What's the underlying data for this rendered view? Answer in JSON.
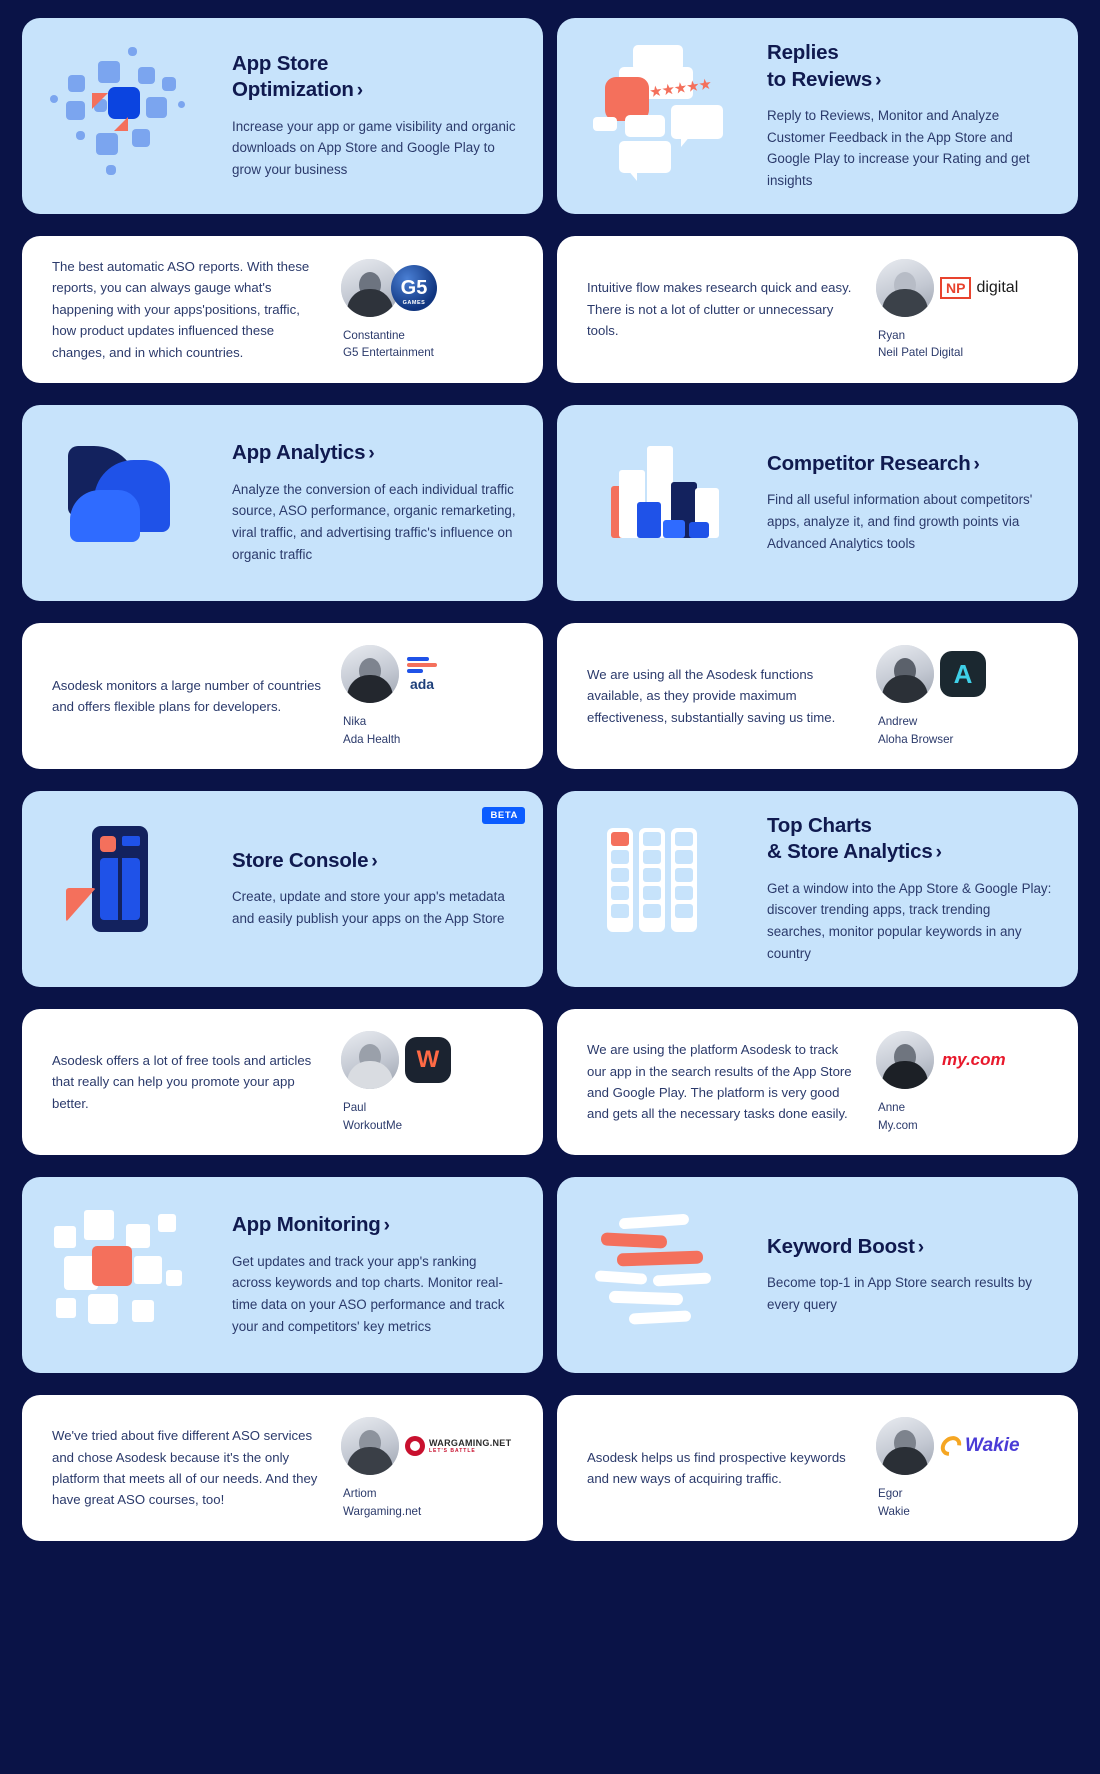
{
  "theme": {
    "page_bg": "#0a1347",
    "feature_card_bg": "#c7e3fb",
    "quote_card_bg": "#ffffff",
    "heading_color": "#101a4f",
    "body_color": "#2b3a6b",
    "accent_blue": "#0b5cff",
    "accent_coral": "#f4705c"
  },
  "features": [
    {
      "id": "app-store-optimization",
      "title_line1": "App Store",
      "title_line2": "Optimization",
      "chevron": "›",
      "description": "Increase your app or game visibility and organic downloads on App Store and Google Play to grow your business",
      "icon": "squares-cluster-icon",
      "badge": null
    },
    {
      "id": "replies-to-reviews",
      "title_line1": "Replies",
      "title_line2": "to Reviews",
      "chevron": "›",
      "description": "Reply to Reviews, Monitor and Analyze Customer Feedback in the App Store and Google Play to increase your Rating and get insights",
      "icon": "speech-bubbles-stars-icon",
      "badge": null
    },
    {
      "id": "app-analytics",
      "title_line1": "App Analytics",
      "title_line2": "",
      "chevron": "›",
      "description": "Analyze the conversion of each individual traffic source, ASO performance, organic remarketing, viral traffic, and advertising traffic's influence on organic traffic",
      "icon": "mountains-chart-icon",
      "badge": null
    },
    {
      "id": "competitor-research",
      "title_line1": "Competitor Research",
      "title_line2": "",
      "chevron": "›",
      "description": "Find all useful information about competitors' apps, analyze it, and find growth points via Advanced Analytics tools",
      "icon": "bar-blocks-icon",
      "badge": null
    },
    {
      "id": "store-console",
      "title_line1": "Store Console",
      "title_line2": "",
      "chevron": "›",
      "description": "Create, update and store your app's metadata and easily publish your apps on the App Store",
      "icon": "phone-screen-icon",
      "badge": "BETA"
    },
    {
      "id": "top-charts-store-analytics",
      "title_line1": "Top Charts",
      "title_line2": "& Store Analytics",
      "chevron": "›",
      "description": "Get a window into the App Store & Google Play: discover trending apps, track trending searches, monitor popular keywords in any country",
      "icon": "chart-columns-icon",
      "badge": null
    },
    {
      "id": "app-monitoring",
      "title_line1": "App Monitoring",
      "title_line2": "",
      "chevron": "›",
      "description": "Get updates and track your app's ranking across keywords and top charts. Monitor real-time data on your ASO performance and track your and competitors' key metrics",
      "icon": "overlapping-squares-icon",
      "badge": null
    },
    {
      "id": "keyword-boost",
      "title_line1": "Keyword Boost",
      "title_line2": "",
      "chevron": "›",
      "description": "Become top-1 in App Store search results by every query",
      "icon": "stacked-bars-icon",
      "badge": null
    }
  ],
  "testimonials": [
    {
      "id": "constantine-g5",
      "text": "The best automatic ASO reports. With these reports, you can always gauge what's happening with your apps'positions, traffic, how product updates influenced these changes, and in which countries.",
      "name": "Constantine",
      "company": "G5 Entertainment",
      "logo": "g5-games-logo",
      "logo_text": "G5",
      "logo_sub": "GAMES"
    },
    {
      "id": "ryan-neil-patel-digital",
      "text": "Intuitive flow makes research quick and easy. There is not a lot of clutter or unnecessary tools.",
      "name": "Ryan",
      "company": "Neil Patel Digital",
      "logo": "np-digital-logo",
      "logo_text": "NP",
      "logo_sub": "digital"
    },
    {
      "id": "nika-ada-health",
      "text": "Asodesk monitors a large number of countries and offers flexible plans for developers.",
      "name": "Nika",
      "company": "Ada Health",
      "logo": "ada-health-logo",
      "logo_text": "ada",
      "logo_sub": ""
    },
    {
      "id": "andrew-aloha-browser",
      "text": "We are using all the Asodesk functions available, as they provide maximum effectiveness, substantially saving us time.",
      "name": "Andrew",
      "company": "Aloha Browser",
      "logo": "aloha-browser-logo",
      "logo_text": "A",
      "logo_sub": ""
    },
    {
      "id": "paul-workoutme",
      "text": "Asodesk offers a lot of free tools and articles that really can help you promote your app better.",
      "name": "Paul",
      "company": "WorkoutMe",
      "logo": "workoutme-logo",
      "logo_text": "W",
      "logo_sub": ""
    },
    {
      "id": "anne-my-com",
      "text": "We are using the platform Asodesk to track our app in the search results of the App Store and Google Play. The platform is very good and gets all the necessary tasks done easily.",
      "name": "Anne",
      "company": "My.com",
      "logo": "my-com-logo",
      "logo_text": "my.com",
      "logo_sub": ""
    },
    {
      "id": "artiom-wargaming",
      "text": "We've tried about five different ASO services and chose Asodesk because it's the only platform that meets all of our needs. And they have great ASO courses, too!",
      "name": "Artiom",
      "company": "Wargaming.net",
      "logo": "wargaming-net-logo",
      "logo_text": "WARGAMING.NET",
      "logo_sub": "LET'S BATTLE"
    },
    {
      "id": "egor-wakie",
      "text": "Asodesk helps us find prospective keywords and new ways of acquiring traffic.",
      "name": "Egor",
      "company": "Wakie",
      "logo": "wakie-logo",
      "logo_text": "Wakie",
      "logo_sub": ""
    }
  ]
}
